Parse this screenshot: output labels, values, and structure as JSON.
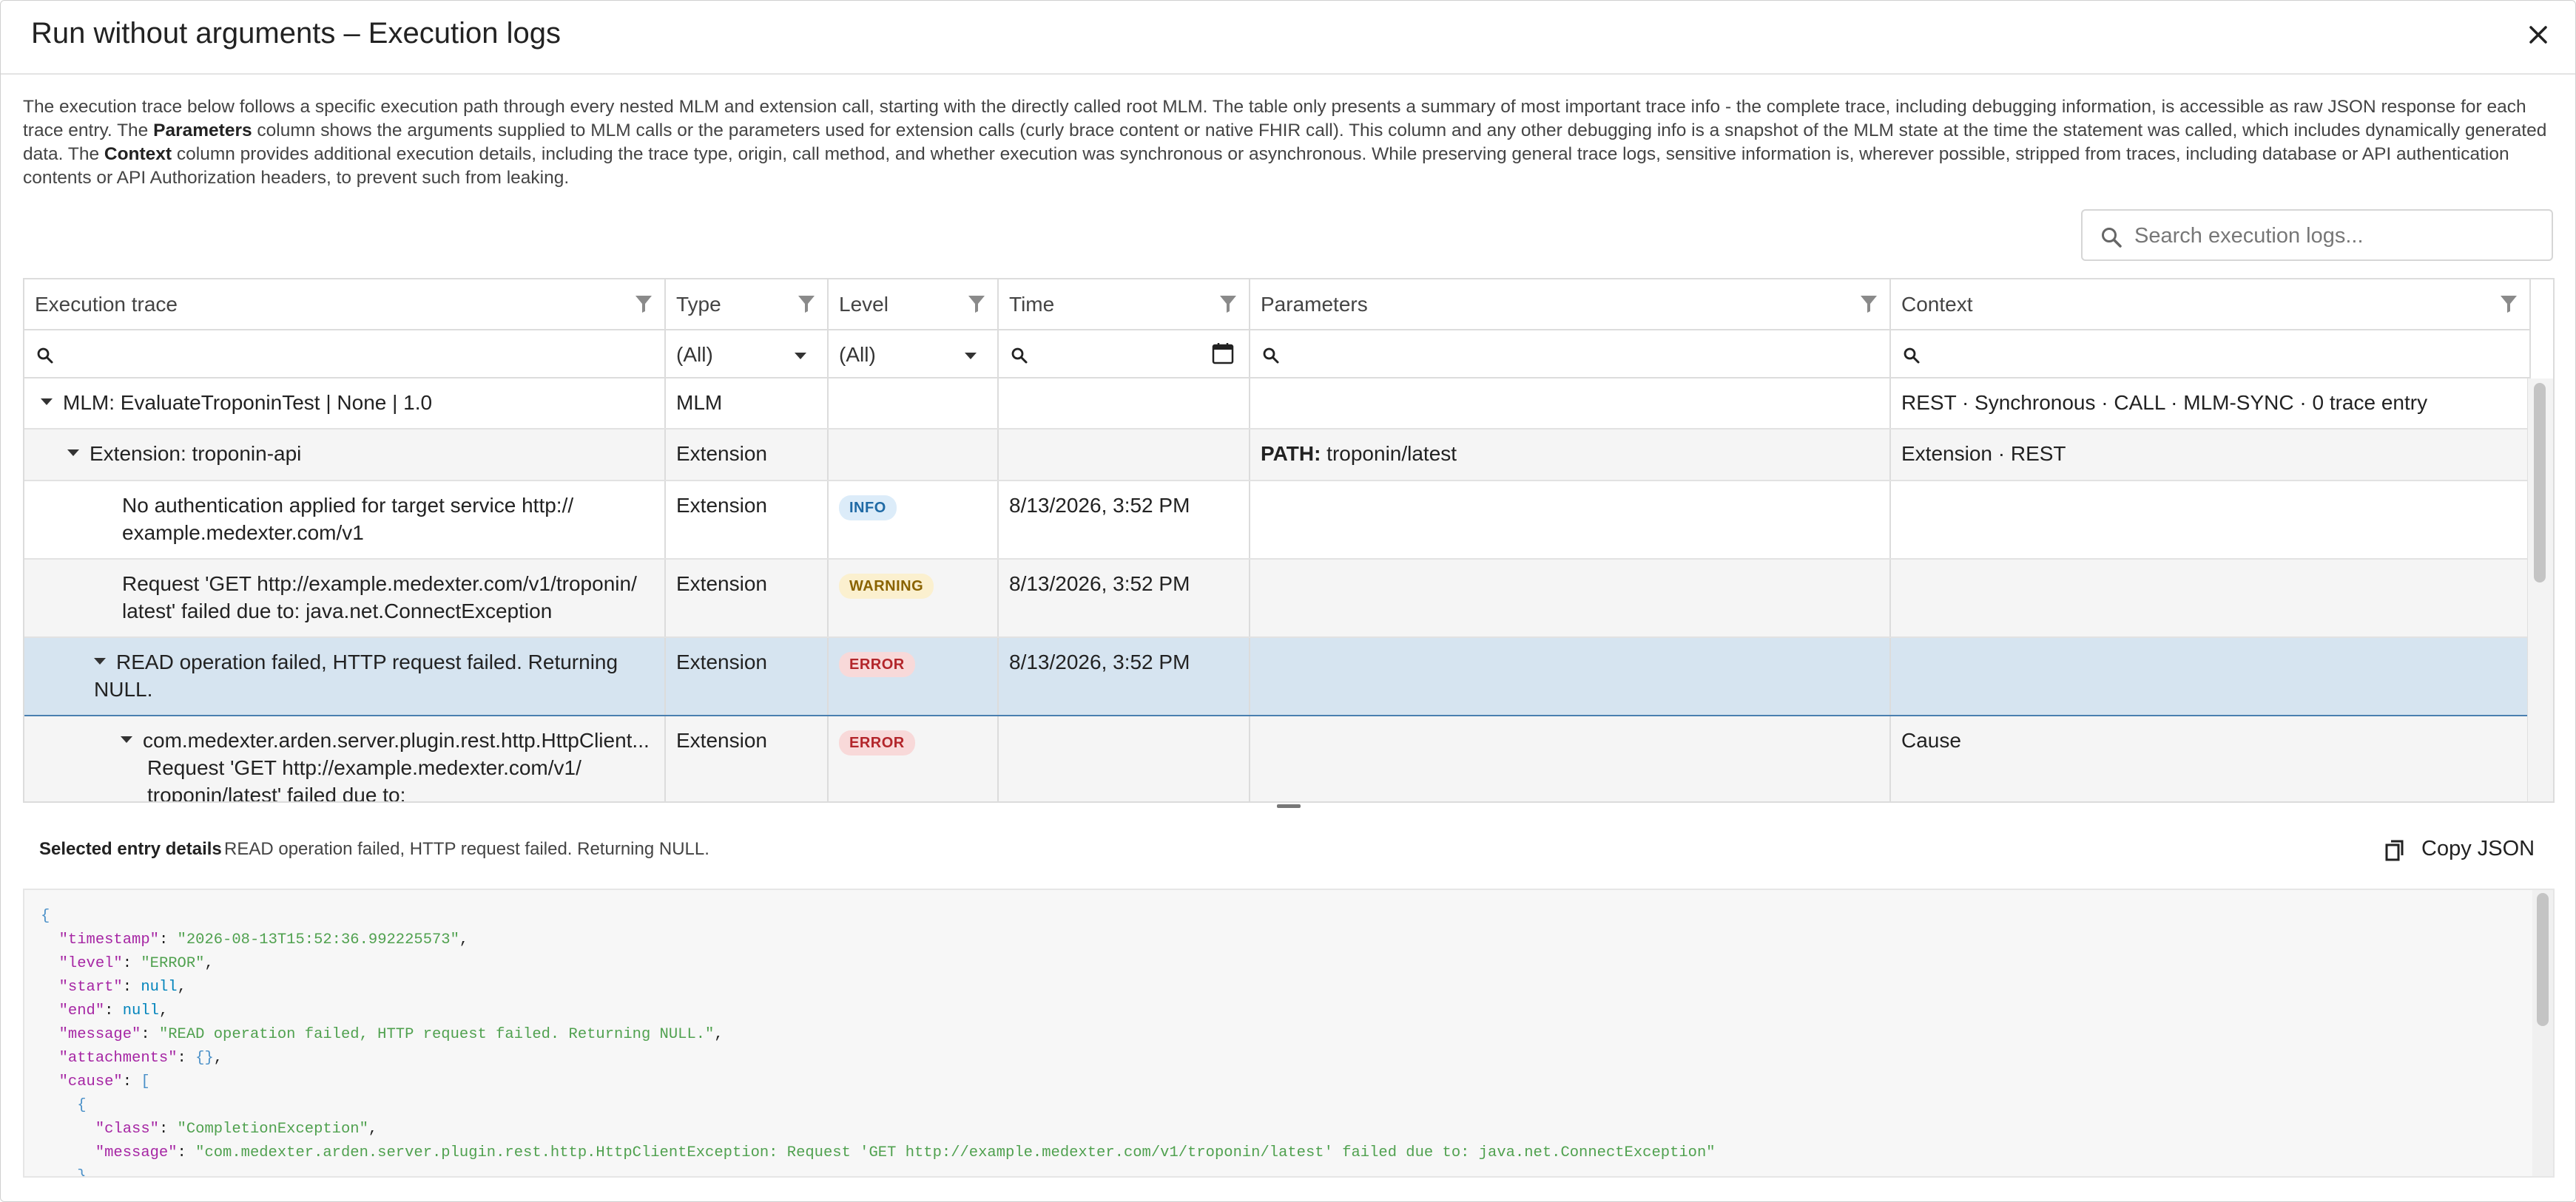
{
  "dialog": {
    "title": "Run without arguments – Execution logs",
    "description": {
      "p1": "The execution trace below follows a specific execution path through every nested MLM and extension call, starting with the directly called root MLM. The table only presents a summary of most important trace info - the complete trace, including debugging information, is accessible as raw JSON response for each trace entry. The ",
      "b1": "Parameters",
      "p2": " column shows the arguments supplied to MLM calls or the parameters used for extension calls (curly brace content or native FHIR call). This column and any other debugging info is a snapshot of the MLM state at the time the statement was called, which includes dynamically generated data. The ",
      "b2": "Context",
      "p3": " column provides additional execution details, including the trace type, origin, call method, and whether execution was synchronous or asynchronous. While preserving general trace logs, sensitive information is, wherever possible, stripped from traces, including database or API authentication contents or API Authorization headers, to prevent such from leaking."
    },
    "search_placeholder": "Search execution logs..."
  },
  "grid": {
    "columns": [
      "Execution trace",
      "Type",
      "Level",
      "Time",
      "Parameters",
      "Context"
    ],
    "filters": {
      "type": "(All)",
      "level": "(All)"
    },
    "rows": [
      {
        "trace": "MLM: EvaluateTroponinTest | None | 1.0",
        "type": "MLM",
        "level": "",
        "time": "",
        "param_key": "",
        "param_val": "",
        "context": "REST · Synchronous · CALL · MLM-SYNC · 0 trace entry"
      },
      {
        "trace": "Extension: troponin-api",
        "type": "Extension",
        "level": "",
        "time": "",
        "param_key": "PATH:",
        "param_val": " troponin/latest",
        "context": "Extension · REST"
      },
      {
        "trace": "No authentication applied for target service http:// example.medexter.com/v1",
        "type": "Extension",
        "level": "INFO",
        "time": "8/13/2026, 3:52 PM",
        "param_key": "",
        "param_val": "",
        "context": ""
      },
      {
        "trace": "Request 'GET http://example.medexter.com/v1/troponin/ latest' failed due to: java.net.ConnectException",
        "type": "Extension",
        "level": "WARNING",
        "time": "8/13/2026, 3:52 PM",
        "param_key": "",
        "param_val": "",
        "context": ""
      },
      {
        "trace": "READ operation failed, HTTP request failed. Returning NULL.",
        "type": "Extension",
        "level": "ERROR",
        "time": "8/13/2026, 3:52 PM",
        "param_key": "",
        "param_val": "",
        "context": ""
      },
      {
        "trace_l1": "com.medexter.arden.server.plugin.rest.http.HttpClient...",
        "trace_l2": "Request 'GET http://example.medexter.com/v1/",
        "trace_l3": "troponin/latest' failed due to:",
        "type": "Extension",
        "level": "ERROR",
        "time": "",
        "param_key": "",
        "param_val": "",
        "context": "Cause"
      }
    ]
  },
  "details": {
    "label": "Selected entry details",
    "text": "READ operation failed, HTTP request failed. Returning NULL.",
    "copy_label": "Copy JSON"
  },
  "json_view": {
    "timestamp": "\"2026-08-13T15:52:36.992225573\"",
    "level": "\"ERROR\"",
    "start": "null",
    "end": "null",
    "message": "\"READ operation failed, HTTP request failed. Returning NULL.\"",
    "attachments": "{}",
    "cause_class": "\"CompletionException\"",
    "cause_message": "\"com.medexter.arden.server.plugin.rest.http.HttpClientException: Request 'GET http://example.medexter.com/v1/troponin/latest' failed due to: java.net.ConnectException\""
  },
  "colors": {
    "selected_row": "#d6e4f0",
    "info": "#1f6aa5",
    "warning": "#8a6300",
    "error": "#b3262b"
  }
}
